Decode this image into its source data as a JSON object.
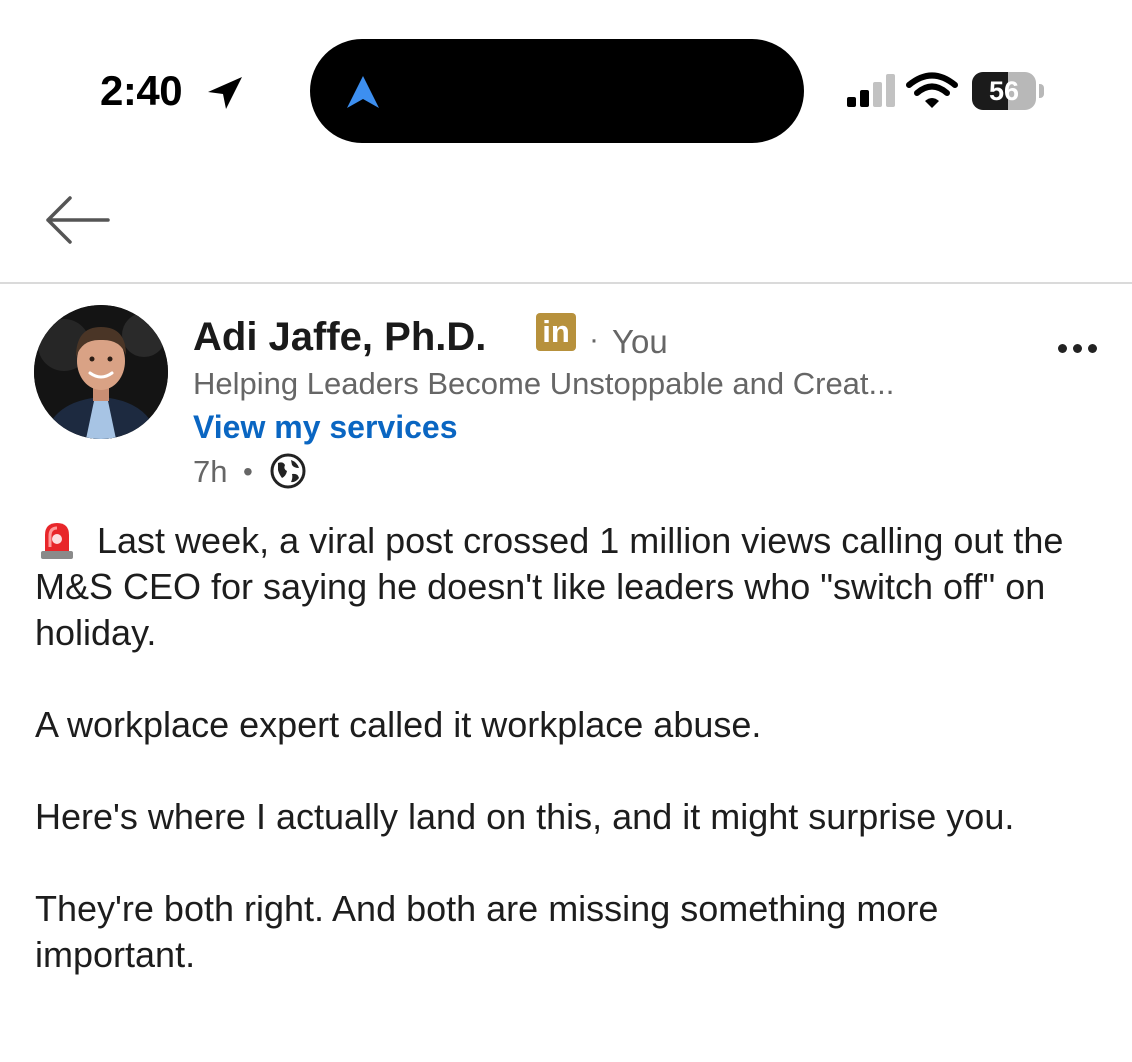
{
  "status_bar": {
    "time": "2:40",
    "battery": "56",
    "battery_level": 0.56
  },
  "icons": {
    "location": "location-arrow-icon",
    "navigation": "navigation-arrow-icon",
    "signal": "cellular-signal-icon",
    "wifi": "wifi-icon",
    "back": "back-arrow-icon",
    "linkedin": "linkedin-badge-icon",
    "more": "more-options-icon",
    "visibility": "globe-icon",
    "siren": "siren-emoji-icon"
  },
  "colors": {
    "link": "#0a66c2",
    "badge": "#b7913c",
    "muted_text": "#666666"
  },
  "post": {
    "author": "Adi Jaffe, Ph.D.",
    "badge_text": "in",
    "separator": "·",
    "relation": "You",
    "headline": "Helping Leaders Become Unstoppable and Creat...",
    "services_link": "View my services",
    "time_ago": "7h",
    "time_separator": "•",
    "paragraphs": [
      "Last week, a viral post crossed 1 million views calling out the M&S CEO for saying he doesn't like leaders who \"switch off\" on holiday.",
      "A workplace expert called it workplace abuse.",
      "Here's where I actually land on this, and it might surprise you.",
      "They're both right. And both are missing something more important."
    ]
  }
}
